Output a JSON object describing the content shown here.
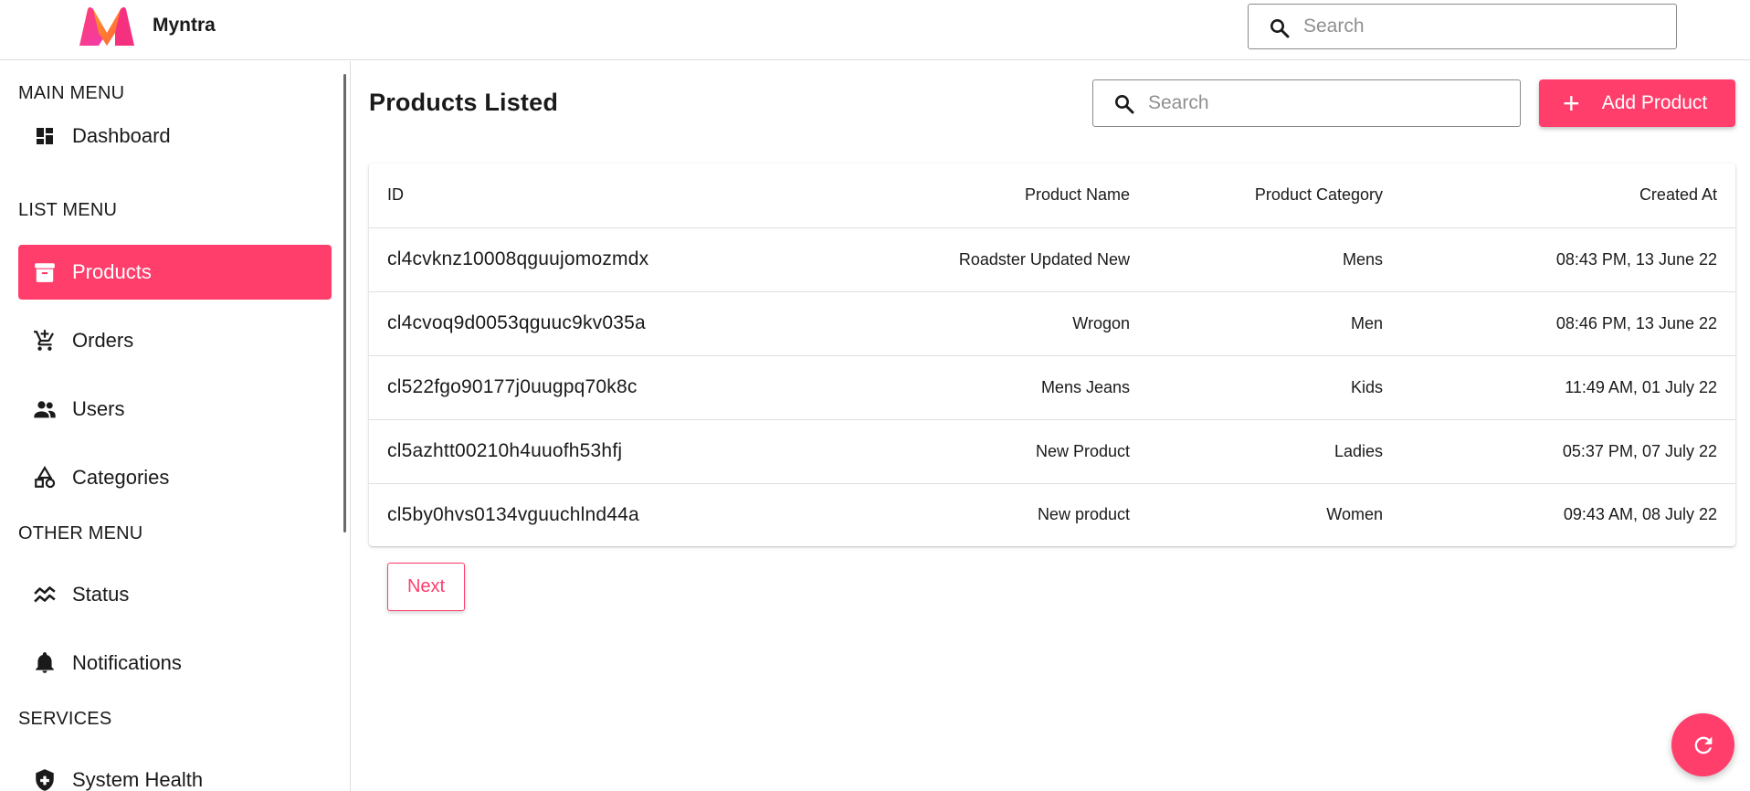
{
  "header": {
    "brand": "Myntra",
    "search_placeholder": "Search",
    "logo_colors": [
      "#ff3f6c",
      "#f5317f",
      "#ff7a2f",
      "#f13ab1"
    ]
  },
  "sidebar": {
    "sections": [
      {
        "title": "MAIN MENU",
        "items": [
          {
            "label": "Dashboard",
            "icon": "dashboard-icon",
            "active": false
          }
        ]
      },
      {
        "title": "LIST MENU",
        "items": [
          {
            "label": "Products",
            "icon": "archive-icon",
            "active": true
          },
          {
            "label": "Orders",
            "icon": "cart-add-icon",
            "active": false
          },
          {
            "label": "Users",
            "icon": "people-icon",
            "active": false
          },
          {
            "label": "Categories",
            "icon": "category-shapes-icon",
            "active": false
          }
        ]
      },
      {
        "title": "OTHER MENU",
        "items": [
          {
            "label": "Status",
            "icon": "status-wave-icon",
            "active": false
          },
          {
            "label": "Notifications",
            "icon": "bell-icon",
            "active": false
          }
        ]
      },
      {
        "title": "SERVICES",
        "items": [
          {
            "label": "System Health",
            "icon": "health-shield-icon",
            "active": false
          }
        ]
      }
    ]
  },
  "main": {
    "title": "Products Listed",
    "search_placeholder": "Search",
    "add_button": {
      "icon": "plus-icon",
      "label": "Add Product"
    },
    "table": {
      "columns": [
        "ID",
        "Product Name",
        "Product Category",
        "Created At"
      ],
      "rows": [
        {
          "id": "cl4cvknz10008qguujomozmdx",
          "name": "Roadster Updated New",
          "category": "Mens",
          "created_at": "08:43 PM, 13 June 22"
        },
        {
          "id": "cl4cvoq9d0053qguuc9kv035a",
          "name": "Wrogon",
          "category": "Men",
          "created_at": "08:46 PM, 13 June 22"
        },
        {
          "id": "cl522fgo90177j0uugpq70k8c",
          "name": "Mens Jeans",
          "category": "Kids",
          "created_at": "11:49 AM, 01 July 22"
        },
        {
          "id": "cl5azhtt00210h4uuofh53hfj",
          "name": "New Product",
          "category": "Ladies",
          "created_at": "05:37 PM, 07 July 22"
        },
        {
          "id": "cl5by0hvs0134vguuchlnd44a",
          "name": "New product",
          "category": "Women",
          "created_at": "09:43 AM, 08 July 22"
        }
      ]
    },
    "next_label": "Next",
    "refresh_icon": "refresh-icon"
  },
  "colors": {
    "accent": "#ff3e6c",
    "text": "#1a1a1a",
    "border": "#dcdcdc"
  }
}
